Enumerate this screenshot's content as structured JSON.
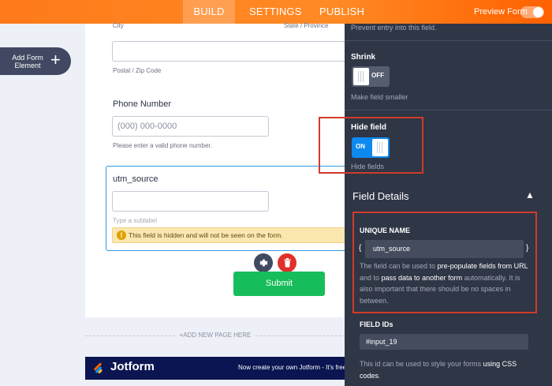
{
  "topbar": {
    "tabs": [
      {
        "label": "BUILD",
        "active": true
      },
      {
        "label": "SETTINGS",
        "active": false
      },
      {
        "label": "PUBLISH",
        "active": false
      }
    ],
    "preview_label": "Preview Form",
    "preview_enabled": false
  },
  "sidebar": {
    "add_element_label": "Add Form Element",
    "add_icon": "+"
  },
  "form": {
    "city_label": "City",
    "state_label": "State / Province",
    "postal_label": "Postal / Zip Code",
    "phone_title": "Phone Number",
    "phone_placeholder": "(000) 000-0000",
    "phone_help": "Please enter a valid phone number.",
    "utm_title": "utm_source",
    "utm_sublabel": "Type a sublabel",
    "hidden_warning": "This field is hidden and will not be seen on the form.",
    "submit_label": "Submit",
    "add_page": "+ADD NEW PAGE HERE",
    "banner_logo": "Jotform",
    "banner_promo": "Now create your own Jotform - It's free!"
  },
  "panel": {
    "prevent_text": "Prevent entry into this field.",
    "shrink": {
      "title": "Shrink",
      "state": "OFF",
      "desc": "Make field smaller"
    },
    "hide": {
      "title": "Hide field",
      "state": "ON",
      "desc": "Hide fields"
    },
    "field_details": "Field Details",
    "unique_name": {
      "title": "UNIQUE NAME",
      "value": "utm_source",
      "open_brace": "{",
      "close_brace": "}",
      "desc_1": "The field can be used to ",
      "desc_b1": "pre-populate fields from URL",
      "desc_2": " and to ",
      "desc_b2": "pass data to another form",
      "desc_3": " automatically. It is also important that there should be no spaces in between."
    },
    "field_ids": {
      "title": "FIELD IDs",
      "value": "#input_19",
      "desc_1": "This id can be used to style your forms ",
      "desc_b1": "using CSS codes",
      "desc_2": "."
    }
  },
  "colors": {
    "brand_orange": "#ff7a1a",
    "panel_bg": "#2f3646",
    "toggle_on": "#0d89f0",
    "submit_green": "#18bd5b",
    "highlight_red": "#d13b2a",
    "selection_blue": "#2f9be0"
  }
}
